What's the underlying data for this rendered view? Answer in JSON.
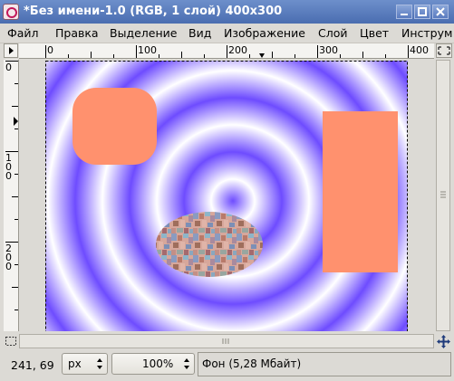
{
  "window": {
    "title": "*Без имени-1.0 (RGB, 1 слой) 400x300"
  },
  "titlebar_buttons": [
    "minimize",
    "maximize",
    "close"
  ],
  "menu": {
    "items": [
      "Файл",
      "Правка",
      "Выделение",
      "Вид",
      "Изображение",
      "Слой",
      "Цвет",
      "Инструм"
    ]
  },
  "ruler": {
    "h_ticks": [
      "0",
      "100",
      "200",
      "300",
      "400"
    ],
    "v_ticks": [
      "0",
      "100",
      "200"
    ]
  },
  "status": {
    "coords": "241, 69",
    "unit": "px",
    "zoom": "100%",
    "layer_info": "Фон (5,28 Мбайт)"
  },
  "colors": {
    "ring_purple": "#7a5cff",
    "ring_white": "#ffffff",
    "salmon": "#ff916e",
    "titlebar": "#5a7bc0"
  },
  "icons": {
    "app": "gimp-icon",
    "nav": "navigate-icon",
    "quickmask": "quickmask-icon",
    "menu_arrow": "image-menu-arrow-icon"
  }
}
